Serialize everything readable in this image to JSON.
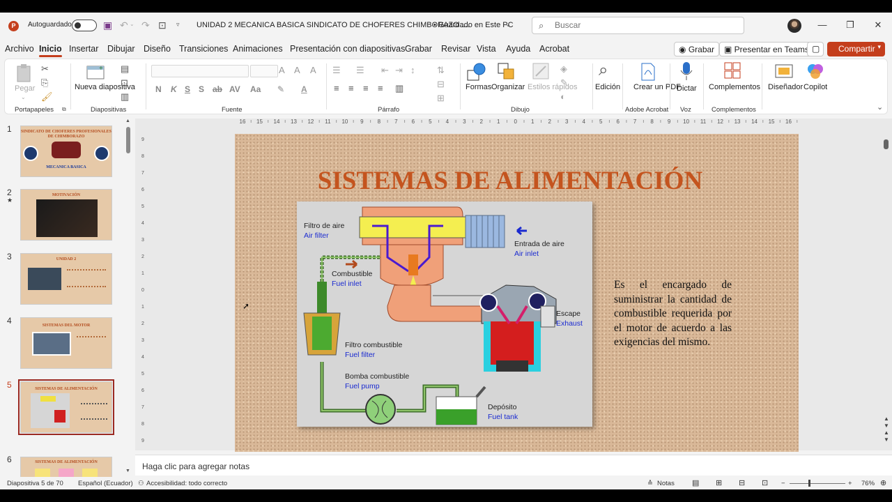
{
  "titlebar": {
    "autosave_label": "Autoguardado",
    "doc_title": "UNIDAD 2 MECANICA BASICA SINDICATO DE CHOFERES CHIMBORAZO ....",
    "save_status": "• Guardado en Este PC",
    "search_placeholder": "Buscar"
  },
  "menu": {
    "tabs": [
      "Archivo",
      "Inicio",
      "Insertar",
      "Dibujar",
      "Diseño",
      "Transiciones",
      "Animaciones",
      "Presentación con diapositivas",
      "Grabar",
      "Revisar",
      "Vista",
      "Ayuda",
      "Acrobat"
    ],
    "active": "Inicio",
    "record_label": "Grabar",
    "teams_label": "Presentar en Teams",
    "share_label": "Compartir"
  },
  "ribbon": {
    "paste": "Pegar",
    "new_slide": "Nueva diapositiva",
    "forms": "Formas",
    "arrange": "Organizar",
    "quick_styles": "Estilos rápidos",
    "edit": "Edición",
    "create_pdf": "Crear un PDF",
    "dictate": "Dictar",
    "addins": "Complementos",
    "designer": "Diseñador",
    "copilot": "Copilot",
    "groups": {
      "clipboard": "Portapapeles",
      "slides": "Diapositivas",
      "font": "Fuente",
      "paragraph": "Párrafo",
      "drawing": "Dibujo",
      "acrobat": "Adobe Acrobat",
      "voice": "Voz",
      "addins": "Complementos"
    }
  },
  "thumbnails": [
    {
      "num": "1",
      "title": "SINDICATO DE CHOFERES PROFESIONALES DE CHIMBORAZO",
      "subtitle": "MECANICA BASICA"
    },
    {
      "num": "2",
      "title": "MOTIVACIÓN",
      "star": "★"
    },
    {
      "num": "3",
      "title": "UNIDAD 2"
    },
    {
      "num": "4",
      "title": "SISTEMAS DEL MOTOR"
    },
    {
      "num": "5",
      "title": "SISTEMAS DE ALIMENTACIÓN"
    },
    {
      "num": "6",
      "title": "SISTEMAS DE ALIMENTACIÓN"
    }
  ],
  "selected_thumb": "5",
  "slide": {
    "title": "SISTEMAS DE ALIMENTACIÓN",
    "body": "Es el encargado de suministrar la cantidad de combustible requerida por el motor de acuerdo a las exigencias del mismo.",
    "diagram": {
      "air_filter": "Filtro de aire",
      "air_filter_en": "Air filter",
      "air_inlet": "Entrada de aire",
      "air_inlet_en": "Air inlet",
      "fuel": "Combustible",
      "fuel_en": "Fuel inlet",
      "exhaust": "Escape",
      "exhaust_en": "Exhaust",
      "fuel_filter": "Filtro combustible",
      "fuel_filter_en": "Fuel filter",
      "fuel_pump": "Bomba combustible",
      "fuel_pump_en": "Fuel pump",
      "tank": "Depósito",
      "tank_en": "Fuel tank"
    }
  },
  "notes_placeholder": "Haga clic para agregar notas",
  "status": {
    "slide_info": "Diapositiva 5 de 70",
    "language": "Español (Ecuador)",
    "accessibility": "Accesibilidad: todo correcto",
    "notes": "Notas",
    "zoom": "76%"
  },
  "colors": {
    "accent": "#c43e1c",
    "slide_title": "#c4541e",
    "diagram_label_en": "#1a2ad0"
  }
}
